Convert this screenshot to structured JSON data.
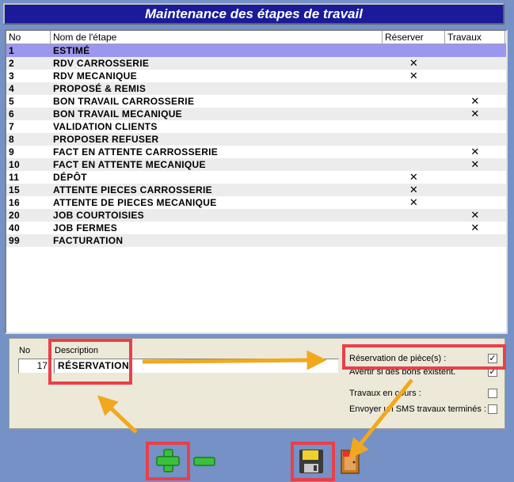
{
  "window": {
    "title": "Maintenance des étapes de travail"
  },
  "grid": {
    "headers": {
      "no": "No",
      "name": "Nom de l'étape",
      "reserver": "Réserver",
      "travaux": "Travaux"
    },
    "rows": [
      {
        "no": "1",
        "name": "ESTIMÉ",
        "reserver": "",
        "travaux": ""
      },
      {
        "no": "2",
        "name": "RDV CARROSSERIE",
        "reserver": "✕",
        "travaux": ""
      },
      {
        "no": "3",
        "name": "RDV MECANIQUE",
        "reserver": "✕",
        "travaux": ""
      },
      {
        "no": "4",
        "name": "PROPOSÉ & REMIS",
        "reserver": "",
        "travaux": ""
      },
      {
        "no": "5",
        "name": "BON TRAVAIL CARROSSERIE",
        "reserver": "",
        "travaux": "✕"
      },
      {
        "no": "6",
        "name": "BON TRAVAIL MECANIQUE",
        "reserver": "",
        "travaux": "✕"
      },
      {
        "no": "7",
        "name": "VALIDATION CLIENTS",
        "reserver": "",
        "travaux": ""
      },
      {
        "no": "8",
        "name": "PROPOSER REFUSER",
        "reserver": "",
        "travaux": ""
      },
      {
        "no": "9",
        "name": "FACT EN ATTENTE CARROSSERIE",
        "reserver": "",
        "travaux": "✕"
      },
      {
        "no": "10",
        "name": "FACT EN ATTENTE MECANIQUE",
        "reserver": "",
        "travaux": "✕"
      },
      {
        "no": "11",
        "name": "DÉPÔT",
        "reserver": "✕",
        "travaux": ""
      },
      {
        "no": "15",
        "name": "ATTENTE PIECES CARROSSERIE",
        "reserver": "✕",
        "travaux": ""
      },
      {
        "no": "16",
        "name": "ATTENTE DE PIECES MECANIQUE",
        "reserver": "✕",
        "travaux": ""
      },
      {
        "no": "20",
        "name": "JOB COURTOISIES",
        "reserver": "",
        "travaux": "✕"
      },
      {
        "no": "40",
        "name": "JOB FERMES",
        "reserver": "",
        "travaux": "✕"
      },
      {
        "no": "99",
        "name": "FACTURATION",
        "reserver": "",
        "travaux": ""
      }
    ]
  },
  "form": {
    "no_label": "No",
    "no_value": "17",
    "desc_label": "Description",
    "desc_value": "RÉSERVATION",
    "reservation_label": "Réservation de pièce(s) :",
    "reservation_checked": "✓",
    "avertir_label": "Avertir si des bons existent.",
    "avertir_checked": "✓",
    "travaux_label": "Travaux en cours :",
    "sms_label": "Envoyer un SMS travaux terminés :"
  },
  "colors": {
    "title_bg": "#1a1a9a",
    "selected_row": "#9b96ef",
    "highlight": "#e8404a",
    "arrow": "#f2a81e",
    "background": "#7591c6"
  },
  "icons": {
    "add": "plus-icon",
    "remove": "minus-icon",
    "save": "floppy-disk-icon",
    "exit": "exit-door-icon"
  }
}
